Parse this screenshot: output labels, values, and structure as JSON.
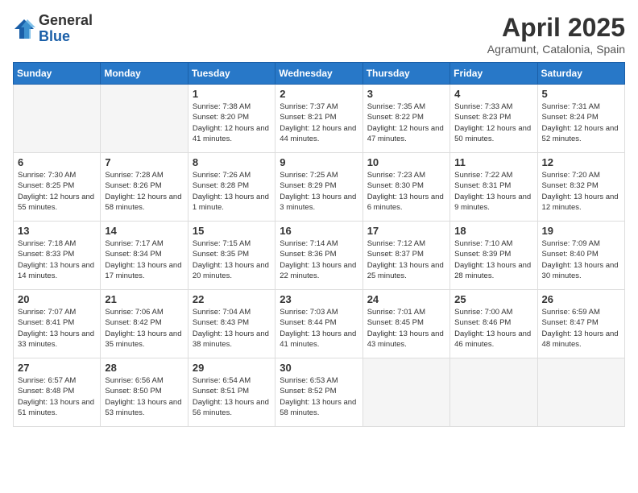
{
  "logo": {
    "general": "General",
    "blue": "Blue"
  },
  "header": {
    "month": "April 2025",
    "location": "Agramunt, Catalonia, Spain"
  },
  "weekdays": [
    "Sunday",
    "Monday",
    "Tuesday",
    "Wednesday",
    "Thursday",
    "Friday",
    "Saturday"
  ],
  "weeks": [
    [
      {
        "day": "",
        "sunrise": "",
        "sunset": "",
        "daylight": ""
      },
      {
        "day": "",
        "sunrise": "",
        "sunset": "",
        "daylight": ""
      },
      {
        "day": "1",
        "sunrise": "Sunrise: 7:38 AM",
        "sunset": "Sunset: 8:20 PM",
        "daylight": "Daylight: 12 hours and 41 minutes."
      },
      {
        "day": "2",
        "sunrise": "Sunrise: 7:37 AM",
        "sunset": "Sunset: 8:21 PM",
        "daylight": "Daylight: 12 hours and 44 minutes."
      },
      {
        "day": "3",
        "sunrise": "Sunrise: 7:35 AM",
        "sunset": "Sunset: 8:22 PM",
        "daylight": "Daylight: 12 hours and 47 minutes."
      },
      {
        "day": "4",
        "sunrise": "Sunrise: 7:33 AM",
        "sunset": "Sunset: 8:23 PM",
        "daylight": "Daylight: 12 hours and 50 minutes."
      },
      {
        "day": "5",
        "sunrise": "Sunrise: 7:31 AM",
        "sunset": "Sunset: 8:24 PM",
        "daylight": "Daylight: 12 hours and 52 minutes."
      }
    ],
    [
      {
        "day": "6",
        "sunrise": "Sunrise: 7:30 AM",
        "sunset": "Sunset: 8:25 PM",
        "daylight": "Daylight: 12 hours and 55 minutes."
      },
      {
        "day": "7",
        "sunrise": "Sunrise: 7:28 AM",
        "sunset": "Sunset: 8:26 PM",
        "daylight": "Daylight: 12 hours and 58 minutes."
      },
      {
        "day": "8",
        "sunrise": "Sunrise: 7:26 AM",
        "sunset": "Sunset: 8:28 PM",
        "daylight": "Daylight: 13 hours and 1 minute."
      },
      {
        "day": "9",
        "sunrise": "Sunrise: 7:25 AM",
        "sunset": "Sunset: 8:29 PM",
        "daylight": "Daylight: 13 hours and 3 minutes."
      },
      {
        "day": "10",
        "sunrise": "Sunrise: 7:23 AM",
        "sunset": "Sunset: 8:30 PM",
        "daylight": "Daylight: 13 hours and 6 minutes."
      },
      {
        "day": "11",
        "sunrise": "Sunrise: 7:22 AM",
        "sunset": "Sunset: 8:31 PM",
        "daylight": "Daylight: 13 hours and 9 minutes."
      },
      {
        "day": "12",
        "sunrise": "Sunrise: 7:20 AM",
        "sunset": "Sunset: 8:32 PM",
        "daylight": "Daylight: 13 hours and 12 minutes."
      }
    ],
    [
      {
        "day": "13",
        "sunrise": "Sunrise: 7:18 AM",
        "sunset": "Sunset: 8:33 PM",
        "daylight": "Daylight: 13 hours and 14 minutes."
      },
      {
        "day": "14",
        "sunrise": "Sunrise: 7:17 AM",
        "sunset": "Sunset: 8:34 PM",
        "daylight": "Daylight: 13 hours and 17 minutes."
      },
      {
        "day": "15",
        "sunrise": "Sunrise: 7:15 AM",
        "sunset": "Sunset: 8:35 PM",
        "daylight": "Daylight: 13 hours and 20 minutes."
      },
      {
        "day": "16",
        "sunrise": "Sunrise: 7:14 AM",
        "sunset": "Sunset: 8:36 PM",
        "daylight": "Daylight: 13 hours and 22 minutes."
      },
      {
        "day": "17",
        "sunrise": "Sunrise: 7:12 AM",
        "sunset": "Sunset: 8:37 PM",
        "daylight": "Daylight: 13 hours and 25 minutes."
      },
      {
        "day": "18",
        "sunrise": "Sunrise: 7:10 AM",
        "sunset": "Sunset: 8:39 PM",
        "daylight": "Daylight: 13 hours and 28 minutes."
      },
      {
        "day": "19",
        "sunrise": "Sunrise: 7:09 AM",
        "sunset": "Sunset: 8:40 PM",
        "daylight": "Daylight: 13 hours and 30 minutes."
      }
    ],
    [
      {
        "day": "20",
        "sunrise": "Sunrise: 7:07 AM",
        "sunset": "Sunset: 8:41 PM",
        "daylight": "Daylight: 13 hours and 33 minutes."
      },
      {
        "day": "21",
        "sunrise": "Sunrise: 7:06 AM",
        "sunset": "Sunset: 8:42 PM",
        "daylight": "Daylight: 13 hours and 35 minutes."
      },
      {
        "day": "22",
        "sunrise": "Sunrise: 7:04 AM",
        "sunset": "Sunset: 8:43 PM",
        "daylight": "Daylight: 13 hours and 38 minutes."
      },
      {
        "day": "23",
        "sunrise": "Sunrise: 7:03 AM",
        "sunset": "Sunset: 8:44 PM",
        "daylight": "Daylight: 13 hours and 41 minutes."
      },
      {
        "day": "24",
        "sunrise": "Sunrise: 7:01 AM",
        "sunset": "Sunset: 8:45 PM",
        "daylight": "Daylight: 13 hours and 43 minutes."
      },
      {
        "day": "25",
        "sunrise": "Sunrise: 7:00 AM",
        "sunset": "Sunset: 8:46 PM",
        "daylight": "Daylight: 13 hours and 46 minutes."
      },
      {
        "day": "26",
        "sunrise": "Sunrise: 6:59 AM",
        "sunset": "Sunset: 8:47 PM",
        "daylight": "Daylight: 13 hours and 48 minutes."
      }
    ],
    [
      {
        "day": "27",
        "sunrise": "Sunrise: 6:57 AM",
        "sunset": "Sunset: 8:48 PM",
        "daylight": "Daylight: 13 hours and 51 minutes."
      },
      {
        "day": "28",
        "sunrise": "Sunrise: 6:56 AM",
        "sunset": "Sunset: 8:50 PM",
        "daylight": "Daylight: 13 hours and 53 minutes."
      },
      {
        "day": "29",
        "sunrise": "Sunrise: 6:54 AM",
        "sunset": "Sunset: 8:51 PM",
        "daylight": "Daylight: 13 hours and 56 minutes."
      },
      {
        "day": "30",
        "sunrise": "Sunrise: 6:53 AM",
        "sunset": "Sunset: 8:52 PM",
        "daylight": "Daylight: 13 hours and 58 minutes."
      },
      {
        "day": "",
        "sunrise": "",
        "sunset": "",
        "daylight": ""
      },
      {
        "day": "",
        "sunrise": "",
        "sunset": "",
        "daylight": ""
      },
      {
        "day": "",
        "sunrise": "",
        "sunset": "",
        "daylight": ""
      }
    ]
  ]
}
